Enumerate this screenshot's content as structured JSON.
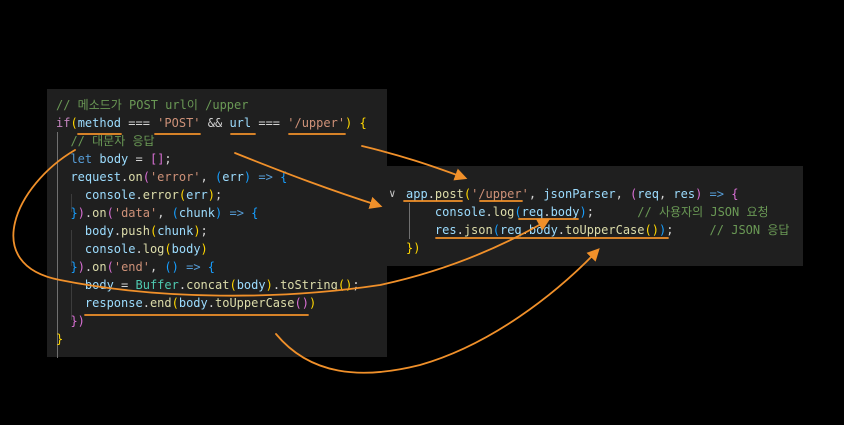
{
  "colors": {
    "background": "#000000",
    "editor_bg": "#1f1f1f",
    "annotation": "#f0902a"
  },
  "left_code": {
    "lines": [
      [
        [
          "// 메소드가 POST url이 /upper",
          "cm"
        ]
      ],
      [
        [
          "if",
          "kw"
        ],
        [
          "(",
          "br1"
        ],
        [
          "method",
          "var"
        ],
        [
          " === ",
          "pl"
        ],
        [
          "'POST'",
          "str"
        ],
        [
          " && ",
          "pl"
        ],
        [
          "url",
          "var"
        ],
        [
          " === ",
          "pl"
        ],
        [
          "'/upper'",
          "str"
        ],
        [
          ")",
          "br1"
        ],
        [
          " ",
          "pl"
        ],
        [
          "{",
          "br1"
        ]
      ],
      [
        [
          "  // 대문자 응답",
          "cm"
        ]
      ],
      [
        [
          "  ",
          "pl"
        ],
        [
          "let",
          "bl"
        ],
        [
          " ",
          "pl"
        ],
        [
          "body",
          "var"
        ],
        [
          " = ",
          "pl"
        ],
        [
          "[]",
          "br2"
        ],
        [
          ";",
          "pl"
        ]
      ],
      [
        [
          "  ",
          "pl"
        ],
        [
          "request",
          "var"
        ],
        [
          ".",
          "pl"
        ],
        [
          "on",
          "fn"
        ],
        [
          "(",
          "br2"
        ],
        [
          "'error'",
          "str"
        ],
        [
          ", ",
          "pl"
        ],
        [
          "(",
          "br3"
        ],
        [
          "err",
          "var"
        ],
        [
          ")",
          "br3"
        ],
        [
          " ",
          "pl"
        ],
        [
          "=>",
          "bl"
        ],
        [
          " ",
          "pl"
        ],
        [
          "{",
          "br3"
        ]
      ],
      [
        [
          "    ",
          "pl"
        ],
        [
          "console",
          "var"
        ],
        [
          ".",
          "pl"
        ],
        [
          "error",
          "fn"
        ],
        [
          "(",
          "br1"
        ],
        [
          "err",
          "var"
        ],
        [
          ")",
          "br1"
        ],
        [
          ";",
          "pl"
        ]
      ],
      [
        [
          "  ",
          "pl"
        ],
        [
          "}",
          "br3"
        ],
        [
          ")",
          "br2"
        ],
        [
          ".",
          "pl"
        ],
        [
          "on",
          "fn"
        ],
        [
          "(",
          "br2"
        ],
        [
          "'data'",
          "str"
        ],
        [
          ", ",
          "pl"
        ],
        [
          "(",
          "br3"
        ],
        [
          "chunk",
          "var"
        ],
        [
          ")",
          "br3"
        ],
        [
          " ",
          "pl"
        ],
        [
          "=>",
          "bl"
        ],
        [
          " ",
          "pl"
        ],
        [
          "{",
          "br3"
        ]
      ],
      [
        [
          "    ",
          "pl"
        ],
        [
          "body",
          "var"
        ],
        [
          ".",
          "pl"
        ],
        [
          "push",
          "fn"
        ],
        [
          "(",
          "br1"
        ],
        [
          "chunk",
          "var"
        ],
        [
          ")",
          "br1"
        ],
        [
          ";",
          "pl"
        ]
      ],
      [
        [
          "    ",
          "pl"
        ],
        [
          "console",
          "var"
        ],
        [
          ".",
          "pl"
        ],
        [
          "log",
          "fn"
        ],
        [
          "(",
          "br1"
        ],
        [
          "body",
          "var"
        ],
        [
          ")",
          "br1"
        ]
      ],
      [
        [
          "  ",
          "pl"
        ],
        [
          "}",
          "br3"
        ],
        [
          ")",
          "br2"
        ],
        [
          ".",
          "pl"
        ],
        [
          "on",
          "fn"
        ],
        [
          "(",
          "br2"
        ],
        [
          "'end'",
          "str"
        ],
        [
          ", ",
          "pl"
        ],
        [
          "()",
          "br3"
        ],
        [
          " ",
          "pl"
        ],
        [
          "=>",
          "bl"
        ],
        [
          " ",
          "pl"
        ],
        [
          "{",
          "br3"
        ]
      ],
      [
        [
          "    ",
          "pl"
        ],
        [
          "body",
          "var"
        ],
        [
          " = ",
          "pl"
        ],
        [
          "Buffer",
          "cls"
        ],
        [
          ".",
          "pl"
        ],
        [
          "concat",
          "fn"
        ],
        [
          "(",
          "br1"
        ],
        [
          "body",
          "var"
        ],
        [
          ")",
          "br1"
        ],
        [
          ".",
          "pl"
        ],
        [
          "toString",
          "fn"
        ],
        [
          "()",
          "br1"
        ],
        [
          ";",
          "pl"
        ]
      ],
      [
        [
          "    ",
          "pl"
        ],
        [
          "response",
          "var"
        ],
        [
          ".",
          "pl"
        ],
        [
          "end",
          "fn"
        ],
        [
          "(",
          "br1"
        ],
        [
          "body",
          "var"
        ],
        [
          ".",
          "pl"
        ],
        [
          "toUpperCase",
          "fn"
        ],
        [
          "()",
          "br2"
        ],
        [
          ")",
          "br1"
        ]
      ],
      [
        [
          "  ",
          "pl"
        ],
        [
          "})",
          "br2"
        ]
      ],
      [
        [
          "}",
          "br1"
        ]
      ]
    ]
  },
  "right_code": {
    "lines": [
      [
        [
          "app",
          "var"
        ],
        [
          ".",
          "pl"
        ],
        [
          "post",
          "fn"
        ],
        [
          "(",
          "br1"
        ],
        [
          "'/upper'",
          "str"
        ],
        [
          ", ",
          "pl"
        ],
        [
          "jsonParser",
          "var"
        ],
        [
          ", ",
          "pl"
        ],
        [
          "(",
          "br2"
        ],
        [
          "req",
          "var"
        ],
        [
          ", ",
          "pl"
        ],
        [
          "res",
          "var"
        ],
        [
          ")",
          "br2"
        ],
        [
          " ",
          "pl"
        ],
        [
          "=>",
          "bl"
        ],
        [
          " ",
          "pl"
        ],
        [
          "{",
          "br2"
        ]
      ],
      [
        [
          "    ",
          "pl"
        ],
        [
          "console",
          "var"
        ],
        [
          ".",
          "pl"
        ],
        [
          "log",
          "fn"
        ],
        [
          "(",
          "br3"
        ],
        [
          "req",
          "var"
        ],
        [
          ".",
          "pl"
        ],
        [
          "body",
          "var"
        ],
        [
          ")",
          "br3"
        ],
        [
          ";",
          "pl"
        ],
        [
          "      // 사용자의 JSON 요청",
          "cm"
        ]
      ],
      [
        [
          "    ",
          "pl"
        ],
        [
          "res",
          "var"
        ],
        [
          ".",
          "pl"
        ],
        [
          "json",
          "fn"
        ],
        [
          "(",
          "br3"
        ],
        [
          "req",
          "var"
        ],
        [
          ".",
          "pl"
        ],
        [
          "body",
          "var"
        ],
        [
          ".",
          "pl"
        ],
        [
          "toUpperCase",
          "fn"
        ],
        [
          "()",
          "br1"
        ],
        [
          ")",
          "br3"
        ],
        [
          ";",
          "pl"
        ],
        [
          "     // JSON 응답",
          "cm"
        ]
      ],
      [
        [
          "})",
          "br1"
        ]
      ]
    ]
  }
}
